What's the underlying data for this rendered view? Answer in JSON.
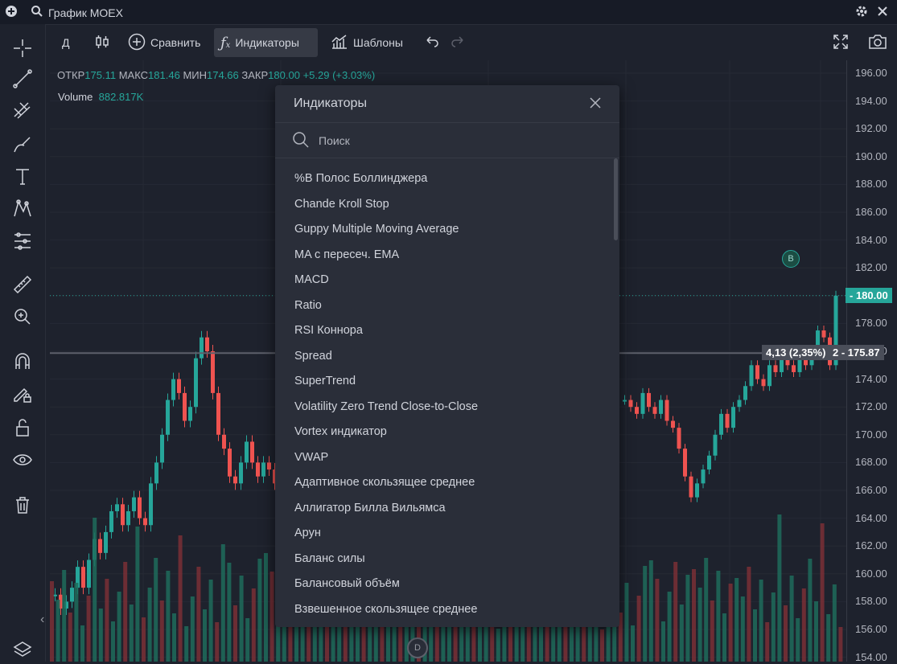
{
  "titlebar": {
    "title": "График MOEX"
  },
  "toolbar": {
    "interval": "Д",
    "compare": "Сравнить",
    "indicators": "Индикаторы",
    "templates": "Шаблоны"
  },
  "legend": {
    "open_label": "ОТКР",
    "open": "175.11",
    "high_label": "МАКС",
    "high": "181.46",
    "low_label": "МИН",
    "low": "174.66",
    "close_label": "ЗАКР",
    "close": "180.00",
    "change": "+5.29 (+3.03%)",
    "volume_label": "Volume",
    "volume": "882.817K"
  },
  "price_axis": [
    "196.00",
    "194.00",
    "192.00",
    "190.00",
    "188.00",
    "186.00",
    "184.00",
    "182.00",
    "180.00",
    "178.00",
    "176.00",
    "174.00",
    "172.00",
    "170.00",
    "168.00",
    "166.00",
    "164.00",
    "162.00",
    "160.00",
    "158.00",
    "156.00",
    "154.00"
  ],
  "labels": {
    "last_price": "180.00",
    "crosshair_price": "175.87",
    "crosshair_idx": "2",
    "measure": "4,13 (2,35%)",
    "marker_b": "B",
    "marker_d": "D",
    "collapse": "‹"
  },
  "modal": {
    "title": "Индикаторы",
    "search_placeholder": "Поиск",
    "items": [
      "%B Полос Боллинджера",
      "Chande Kroll Stop",
      "Guppy Multiple Moving Average",
      "MA с пересеч. EMA",
      "MACD",
      "Ratio",
      "RSI Коннора",
      "Spread",
      "SuperTrend",
      "Volatility Zero Trend Close-to-Close",
      "Vortex индикатор",
      "VWAP",
      "Адаптивное скользящее среднее",
      "Аллигатор Билла Вильямса",
      "Арун",
      "Баланс силы",
      "Балансовый объём",
      "Взвешенное скользящее среднее"
    ]
  },
  "colors": {
    "up": "#26a69a",
    "down": "#ef5350",
    "bg": "#1e222d",
    "panel": "#2a2e39"
  }
}
